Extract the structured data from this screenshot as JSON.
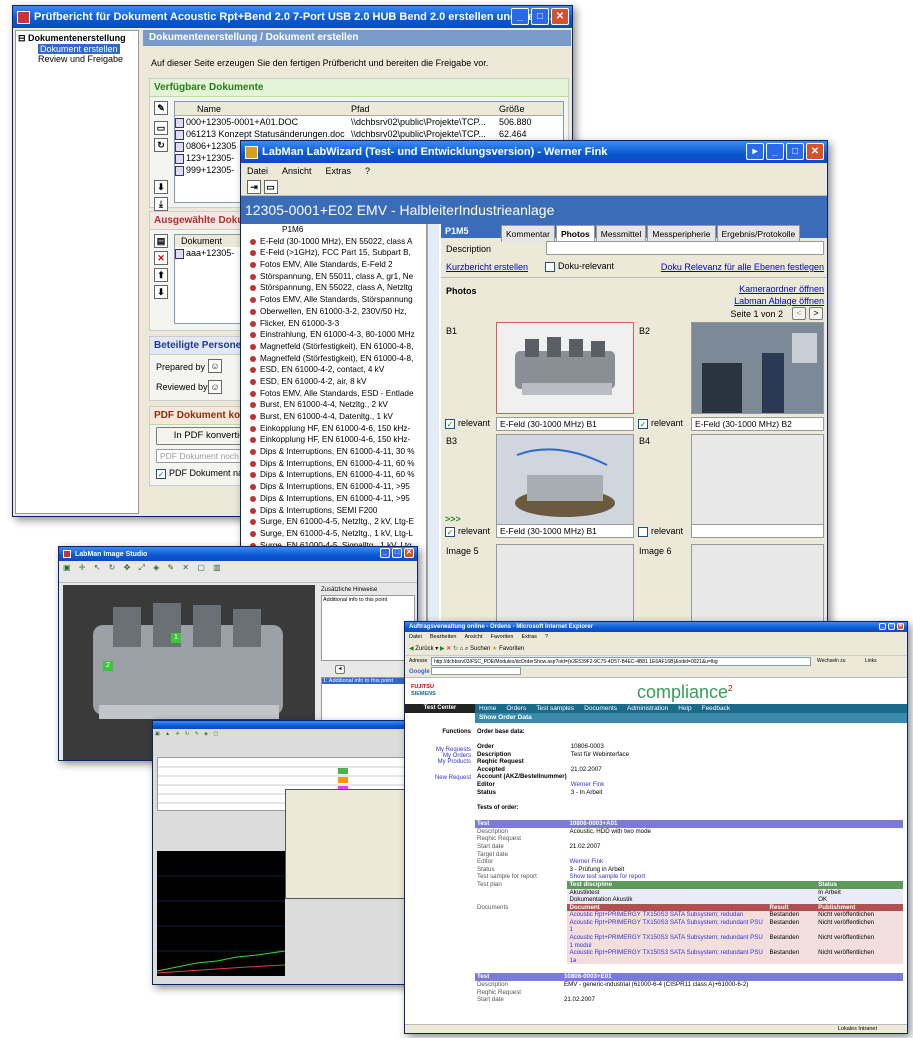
{
  "pruef": {
    "title": "Prüfbericht für Dokument Acoustic Rpt+Bend 2.0 7-Port USB 2.0 HUB Bend 2.0 erstellen und freig...",
    "tree": {
      "root": "Dokumentenerstellung",
      "item1": "Dokument erstellen",
      "item2": "Review und Freigabe"
    },
    "header": "Dokumentenerstellung / Dokument erstellen",
    "intro": "Auf dieser Seite erzeugen Sie den fertigen Prüfbericht und bereiten die Freigabe vor.",
    "verfuegbar": "Verfügbare Dokumente",
    "columns": {
      "name": "Name",
      "pfad": "Pfad",
      "groesse": "Größe"
    },
    "docs": [
      {
        "name": "000+12305-0001+A01.DOC",
        "pfad": "\\\\dchbsrv02\\public\\Projekte\\TCP...",
        "size": "506.880"
      },
      {
        "name": "061213 Konzept Statusänderungen.doc",
        "pfad": "\\\\dchbsrv02\\public\\Projekte\\TCP...",
        "size": "62.464"
      },
      {
        "name": "0806+12305",
        "pfad": "",
        "size": ""
      },
      {
        "name": "123+12305-",
        "pfad": "",
        "size": ""
      },
      {
        "name": "999+12305-",
        "pfad": "",
        "size": ""
      }
    ],
    "ausgewaehlt": "Ausgewählte Dokumente",
    "sel_col": "Dokument",
    "sel_item": "aaa+12305-",
    "beteiligte": "Beteiligte Personen",
    "prepared": "Prepared by",
    "reviewed": "Reviewed by",
    "pdf_head": "PDF Dokument konvertieren",
    "pdf_btn": "In PDF konvertieren",
    "pdf_placeholder": "PDF Dokument noch",
    "pdf_check": "PDF Dokument nach"
  },
  "wizard": {
    "title": "LabMan LabWizard (Test- und Entwicklungsversion) - Werner Fink",
    "menu": [
      "Datei",
      "Ansicht",
      "Extras",
      "?"
    ],
    "header": "12305-0001+E02 EMV - HalbleiterIndustrieanlage",
    "tree_first": "P1M6",
    "tree": [
      "E-Feld (30-1000 MHz), EN 55022, class A",
      "E-Feld (>1GHz), FCC Part 15, Subpart B,",
      "Fotos EMV, Alle Standards, E-Feld 2",
      "Störspannung, EN 55011, class A, gr1, Ne",
      "Störspannung, EN 55022, class A, Netzltg",
      "Fotos EMV, Alle Standards, Störspannung",
      "Oberwellen, EN 61000-3-2, 230V/50 Hz,",
      "Flicker, EN 61000-3-3",
      "Einstrahlung, EN 61000-4-3, 80-1000 MHz",
      "Magnetfeld (Störfestigkeit), EN 61000-4-8,",
      "Magnetfeld (Störfestigkeit), EN 61000-4-8,",
      "ESD, EN 61000-4-2, contact, 4 kV",
      "ESD, EN 61000-4-2, air, 8 kV",
      "Fotos EMV, Alle Standards, ESD - Entlade",
      "Burst, EN 61000-4-4, Netzltg., 2 kV",
      "Burst, EN 61000-4-4, Datenltg., 1 kV",
      "Einkopplung HF, EN 61000-4-6, 150 kHz-",
      "Einkopplung HF, EN 61000-4-6, 150 kHz-",
      "Dips & Interruptions, EN 61000-4-11, 30 %",
      "Dips & Interruptions, EN 61000-4-11, 60 %",
      "Dips & Interruptions, EN 61000-4-11, 60 %",
      "Dips & Interruptions, EN 61000-4-11, >95",
      "Dips & Interruptions, EN 61000-4-11, >95",
      "Dips & Interruptions, SEMI F200",
      "Surge, EN 61000-4-5, Netzltg., 2 kV, Ltg-E",
      "Surge, EN 61000-4-5, Netzltg., 1 kV, Ltg-L",
      "Surge, EN 61000-4-5, Signalltg., 1 kV, Ltg"
    ],
    "p1m5": "P1M5",
    "tabs": [
      "Kommentar",
      "Photos",
      "Messmittel",
      "Messperipherie",
      "Ergebnis/Protokolle"
    ],
    "description": "Description",
    "kurz": "Kurzbericht erstellen",
    "doku": "Doku-relevant",
    "doku_link": "Doku Relevanz für alle Ebenen festlegen",
    "photos": "Photos",
    "kamera": "Kameraordner öffnen",
    "ablage": "Labman Ablage öffnen",
    "seite": "Seite 1 von 2",
    "b1": "B1",
    "b2": "B2",
    "b3": "B3",
    "b4": "B4",
    "img5": "Image 5",
    "img6": "Image 6",
    "relevant": "relevant",
    "cap1": "E-Feld (30-1000 MHz) B1",
    "cap2": "E-Feld (30-1000 MHz) B2",
    "cap3": "E-Feld (30-1000 MHz) B1",
    "arrows": ">>>"
  },
  "studio": {
    "title": "LabMan Image Studio",
    "hint_head": "Zusätzliche Hinweise",
    "hint": "Additional info to this point",
    "list_item": "1: Additional info to this point",
    "m1": "1",
    "m2": "2",
    "m3": "3"
  },
  "ie": {
    "title": "Auftragsverwaltung online - Ordens - Microsoft Internet Explorer",
    "menu": [
      "Datei",
      "Bearbeiten",
      "Ansicht",
      "Favoriten",
      "Extras",
      "?"
    ],
    "address_label": "Adresse",
    "address": "http://dchbsrv03/FSC_PDE/Modules/dcOrderShow.asp?oid={e2E539F2-9C75-4D57-B4EC-4B81 1E6AF16B}&odid=0021&u=lbg",
    "wechseln": "Wechseln zu",
    "links": "Links",
    "logo1": "FUJITSU",
    "logo2": "SIEMENS",
    "compliance": "compliance",
    "sup": "2",
    "nav": [
      "Home",
      "Orders",
      "Test samples",
      "Documents",
      "Administration",
      "Help",
      "Feedback"
    ],
    "tc": "Test Center",
    "page_title": "Show Order Data",
    "side": [
      "Functions",
      "My Requests",
      "My Orders",
      "My Products",
      "New Request"
    ],
    "obd": "Order base data:",
    "order": [
      [
        "Order",
        "10806-0003"
      ],
      [
        "Description",
        "Test für Webinterface"
      ],
      [
        "Reqhic Request",
        ""
      ],
      [
        "Accepted",
        "21.02.2007"
      ],
      [
        "Account (AKZ/Bestellnummer)",
        ""
      ],
      [
        "Editor",
        "Werner Fink"
      ],
      [
        "Status",
        "3 - In Arbeit"
      ]
    ],
    "tests": "Tests of order:",
    "t1": {
      "test": "10806-0003+A01",
      "desc": "Acoustic, HDD with two mode",
      "start": "21.02.2007",
      "editor": "Werner Fink",
      "status": "3 - Prüfung in Arbeit",
      "report": "Show test sample for report"
    },
    "labels": [
      "Test",
      "Description",
      "Reqhic Request",
      "Start date",
      "Target date",
      "Editor",
      "Status",
      "Test sample for report",
      "Test plan",
      "Documents"
    ],
    "disc": [
      [
        "Test discipline",
        "Status"
      ],
      [
        "Akustiktest",
        "In Arbeit"
      ],
      [
        "Dokumentation Akustik",
        "OK"
      ]
    ],
    "docs_head": [
      "Document",
      "Result",
      "Publishment"
    ],
    "docs": [
      [
        "Acoustic Rpt+PRIMERGY TX150S3 SATA Subsystem; redudan",
        "Bestanden",
        "Nicht veröffentlichen"
      ],
      [
        "Acoustic Rpt+PRIMERGY TX150S3 SATA Subsystem; redundant PSU 1",
        "Bestanden",
        "Nicht veröffentlichen"
      ],
      [
        "Acoustic Rpt+PRIMERGY TX150S3 SATA Subsystem; redundant PSU 1 modul",
        "Bestanden",
        "Nicht veröffentlichen"
      ],
      [
        "Acoustic Rpt+PRIMERGY TX150S3 SATA Subsystem; redundant PSU 1a",
        "Bestanden",
        "Nicht veröffentlichen"
      ]
    ],
    "t2": {
      "test": "10806-0003+E01",
      "desc": "EMV - generic-industrial (61000-6-4 (CISPR11 class A)+61000-6-2)",
      "start": "21.02.2007"
    },
    "status": "Lokales Intranet"
  }
}
